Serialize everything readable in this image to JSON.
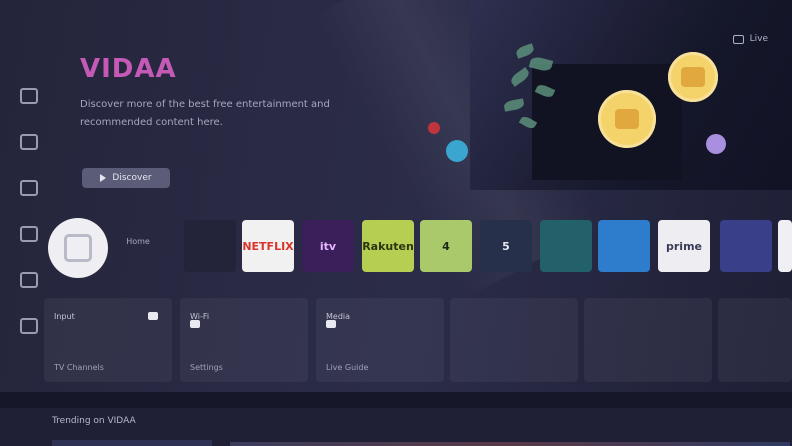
{
  "top_right": {
    "label": "Live"
  },
  "hero": {
    "brand": "VIDAA",
    "description": "Discover more of the best free entertainment and recommended content here.",
    "button_label": "Discover"
  },
  "home": {
    "label": "Home"
  },
  "apps": [
    {
      "name": "app-tile-1",
      "label": "",
      "bg": "#23243a",
      "fg": "#c9cad8"
    },
    {
      "name": "app-tile-2",
      "label": "NETFLIX",
      "bg": "#f1f1f1",
      "fg": "#d9342b"
    },
    {
      "name": "app-tile-3",
      "label": "itv",
      "bg": "#3a1f5a",
      "fg": "#e7b4ff"
    },
    {
      "name": "app-tile-4",
      "label": "Rakuten",
      "bg": "#b6cf52",
      "fg": "#2d3412"
    },
    {
      "name": "app-tile-5",
      "label": "4",
      "bg": "#a9c96a",
      "fg": "#1e2a13"
    },
    {
      "name": "app-tile-6",
      "label": "5",
      "bg": "#27304a",
      "fg": "#e7e7ef"
    },
    {
      "name": "app-tile-7",
      "label": "",
      "bg": "#22606a",
      "fg": "#dff7ff"
    },
    {
      "name": "app-tile-8",
      "label": "",
      "bg": "#2d7dcc",
      "fg": "#e8f4ff"
    },
    {
      "name": "app-tile-9",
      "label": "prime",
      "bg": "#eeeef2",
      "fg": "#3a3b56"
    },
    {
      "name": "app-tile-10",
      "label": "",
      "bg": "#3a3f8a",
      "fg": "#f1f2ff"
    },
    {
      "name": "app-tile-11",
      "label": "",
      "bg": "#f0f0f4",
      "fg": "#3a3b56"
    }
  ],
  "widgets": [
    {
      "label": "Input",
      "sub": "",
      "foot": "TV Channels"
    },
    {
      "label": "Wi-Fi",
      "sub": "",
      "foot": "Settings"
    },
    {
      "label": "Media",
      "sub": "",
      "foot": "Live Guide"
    },
    {
      "label": "",
      "sub": "",
      "foot": ""
    },
    {
      "label": "",
      "sub": "",
      "foot": ""
    },
    {
      "label": "",
      "sub": "",
      "foot": ""
    }
  ],
  "bottom": {
    "title": "Trending on VIDAA"
  },
  "colors": {
    "brand": "#c45ab6",
    "background": "#24243a"
  }
}
